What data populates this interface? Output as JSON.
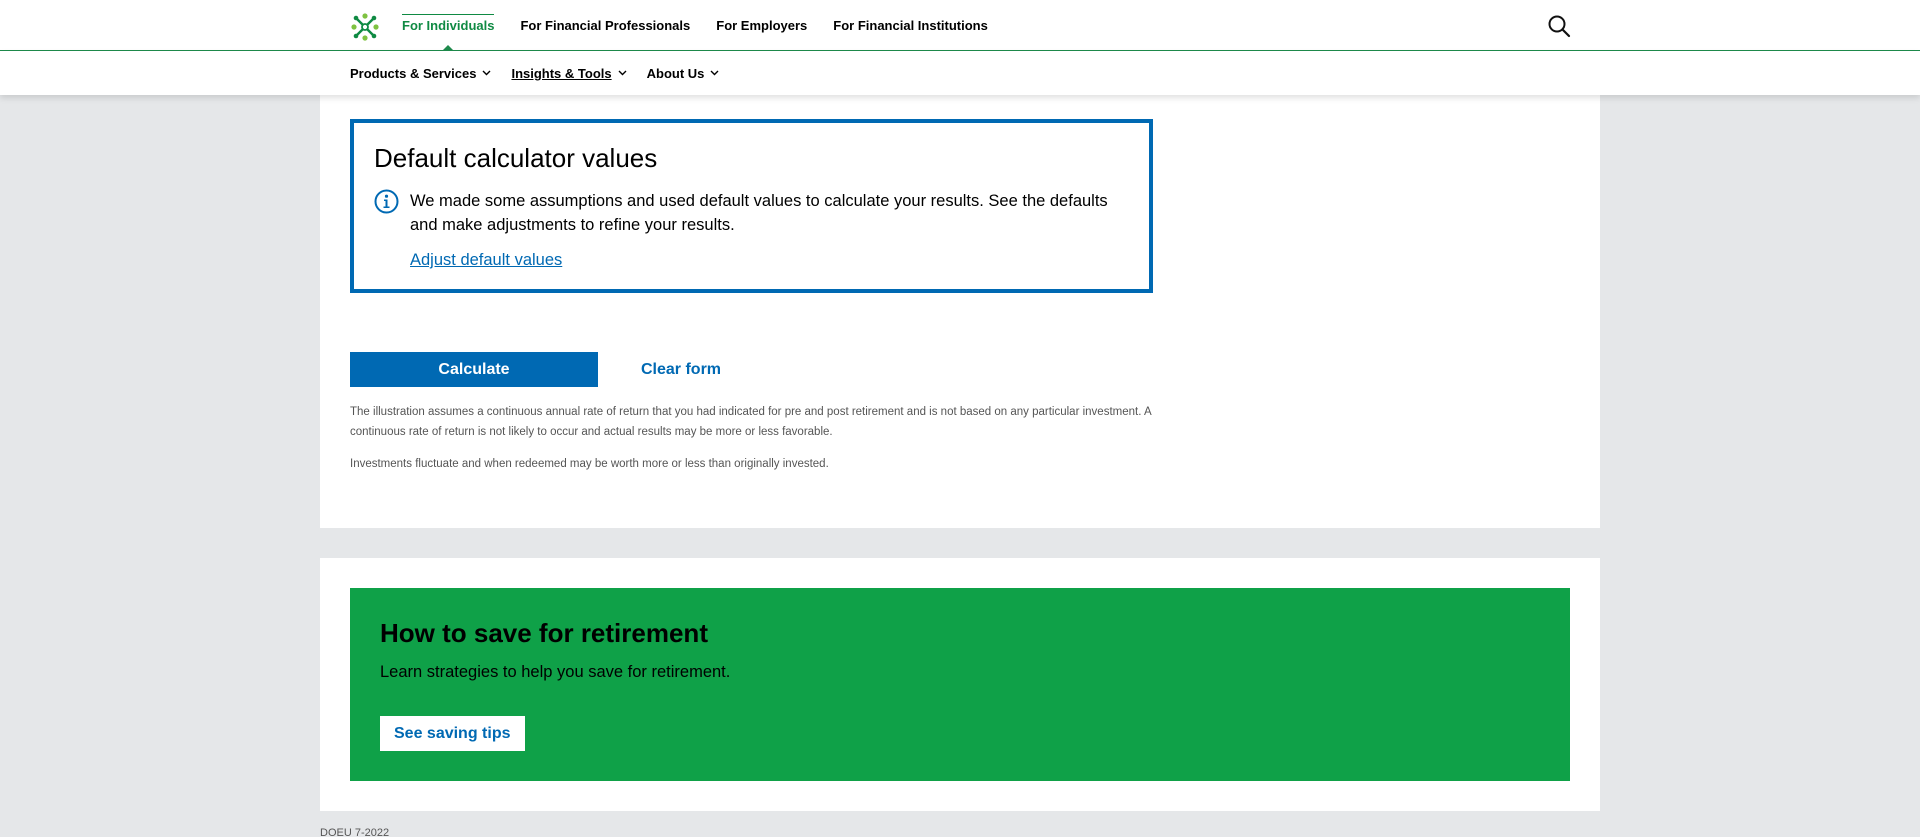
{
  "topnav": {
    "items": [
      {
        "label": "For Individuals"
      },
      {
        "label": "For Financial Professionals"
      },
      {
        "label": "For Employers"
      },
      {
        "label": "For Financial Institutions"
      }
    ]
  },
  "subnav": {
    "items": [
      {
        "label": "Products & Services"
      },
      {
        "label": "Insights & Tools"
      },
      {
        "label": "About Us"
      }
    ]
  },
  "defaults": {
    "title": "Default calculator values",
    "text": "We made some assumptions and used default values to calculate your results. See the defaults and make adjustments to refine your results.",
    "link": "Adjust default values"
  },
  "actions": {
    "calculate": "Calculate",
    "clear": "Clear form"
  },
  "disclaimers": {
    "rate": "The illustration assumes a continuous annual rate of return that you had indicated for pre and post retirement and is not based on any particular investment. A continuous rate of return is not likely to occur and actual results may be more or less favorable.",
    "fluctuate": "Investments fluctuate and when redeemed may be worth more or less than originally invested."
  },
  "promo": {
    "title": "How to save for retirement",
    "text": "Learn strategies to help you save for retirement.",
    "button": "See saving tips"
  },
  "footer": {
    "code": "DOEU 7-2022"
  },
  "colors": {
    "brand_green": "#0f8a43",
    "promo_green": "#0fa148",
    "primary_blue": "#0069b3"
  },
  "icons": [
    "logo-icon",
    "search-icon",
    "chevron-down-icon",
    "info-icon"
  ]
}
